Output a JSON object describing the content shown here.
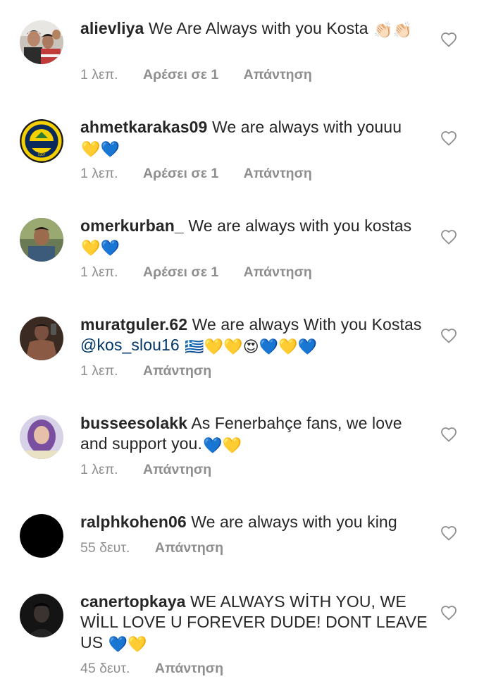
{
  "comments": [
    {
      "username": "alievliya",
      "text_before": "We Are Always with you Kosta",
      "mention": "",
      "text_after": "",
      "emojis": "👏🏻👏🏻",
      "time": "1 λεπ.",
      "likes": "Αρέσει σε 1",
      "reply": "Απάντηση",
      "avatar": "two-people-photo"
    },
    {
      "username": "ahmetkarakas09",
      "text_before": "We are always with youuu",
      "mention": "",
      "text_after": "",
      "emojis": "💛💙",
      "time": "1 λεπ.",
      "likes": "Αρέσει σε 1",
      "reply": "Απάντηση",
      "avatar": "fenerbahce-logo"
    },
    {
      "username": "omerkurban_",
      "text_before": "We are always  with  you kostas",
      "mention": "",
      "text_after": "",
      "emojis": "💛💙",
      "time": "1 λεπ.",
      "likes": "Αρέσει σε 1",
      "reply": "Απάντηση",
      "avatar": "man-outdoor-photo"
    },
    {
      "username": "muratguler.62",
      "text_before": "We are always With you Kostas",
      "mention": "@kos_slou16",
      "text_after": "",
      "emojis": "🇬🇷💛💛😍💙💛💙",
      "time": "1 λεπ.",
      "likes": "",
      "reply": "Απάντηση",
      "avatar": "shirtless-man-photo"
    },
    {
      "username": "busseesolakk",
      "text_before": "As Fenerbahçe fans, we love and support you.",
      "mention": "",
      "text_after": "",
      "emojis": "💙💛",
      "time": "1 λεπ.",
      "likes": "",
      "reply": "Απάντηση",
      "avatar": "woman-hijab-photo"
    },
    {
      "username": "ralphkohen06",
      "text_before": "We are always with you king",
      "mention": "",
      "text_after": "",
      "emojis": "",
      "time": "55 δευτ.",
      "likes": "",
      "reply": "Απάντηση",
      "avatar": "black-avatar"
    },
    {
      "username": "canertopkaya",
      "text_before": "WE ALWAYS WİTH YOU, WE WİLL LOVE U FOREVER DUDE! DONT LEAVE US",
      "mention": "",
      "text_after": "",
      "emojis": "💙💛",
      "time": "45 δευτ.",
      "likes": "",
      "reply": "Απάντηση",
      "avatar": "dark-person-photo"
    }
  ],
  "colors": {
    "text": "#262626",
    "meta": "#8e8e8e",
    "mention": "#003569",
    "heart_stroke": "#8e8e8e"
  },
  "icons": {
    "like": "heart-outline-icon"
  }
}
